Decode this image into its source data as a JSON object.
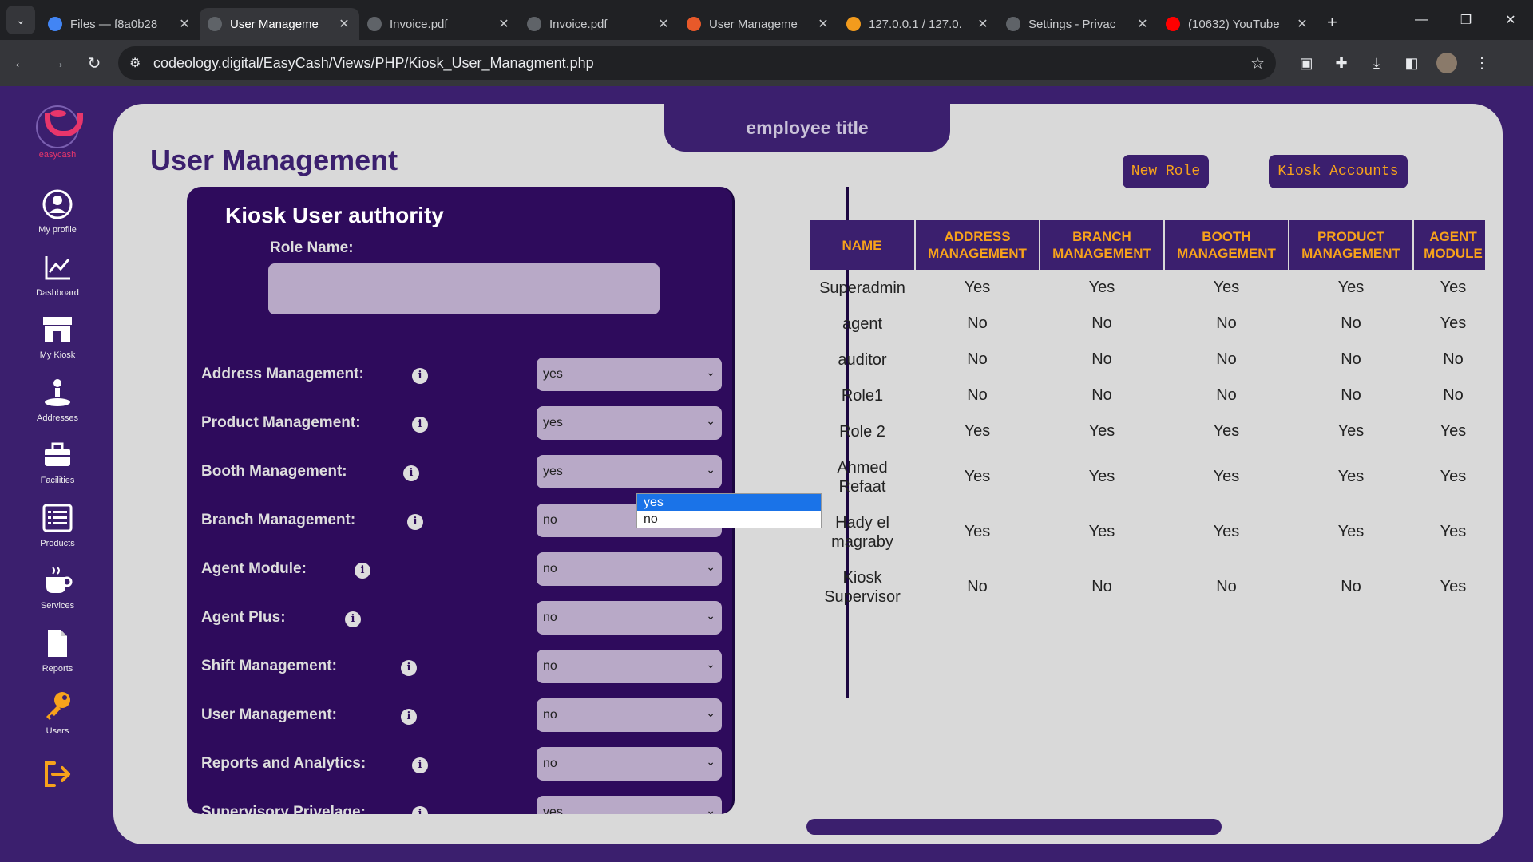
{
  "browser": {
    "tabs": [
      {
        "title": "Files — f8a0b28",
        "icon": "drive-icon",
        "color": "#4285f4"
      },
      {
        "title": "User Manageme",
        "icon": "globe-icon",
        "color": "#5f6368",
        "active": true
      },
      {
        "title": "Invoice.pdf",
        "icon": "globe-icon",
        "color": "#5f6368"
      },
      {
        "title": "Invoice.pdf",
        "icon": "globe-icon",
        "color": "#5f6368"
      },
      {
        "title": "User Manageme",
        "icon": "site-icon",
        "color": "#e8592a"
      },
      {
        "title": "127.0.0.1 / 127.0.",
        "icon": "phpmyadmin-icon",
        "color": "#f29b1d"
      },
      {
        "title": "Settings - Privac",
        "icon": "gear-icon",
        "color": "#5f6368"
      },
      {
        "title": "(10632) YouTube",
        "icon": "youtube-icon",
        "color": "#ff0000"
      }
    ],
    "url": "codeology.digital/EasyCash/Views/PHP/Kiosk_User_Managment.php"
  },
  "sidebar": {
    "brand": "easycash",
    "items": [
      {
        "label": "My profile",
        "icon": "profile-icon"
      },
      {
        "label": "Dashboard",
        "icon": "chart-icon"
      },
      {
        "label": "My Kiosk",
        "icon": "store-icon"
      },
      {
        "label": "Addresses",
        "icon": "location-icon"
      },
      {
        "label": "Facilities",
        "icon": "briefcase-icon"
      },
      {
        "label": "Products",
        "icon": "list-icon"
      },
      {
        "label": "Services",
        "icon": "coffee-icon"
      },
      {
        "label": "Reports",
        "icon": "file-icon"
      },
      {
        "label": "Users",
        "icon": "key-icon"
      }
    ],
    "logout_icon": "logout-icon"
  },
  "header": {
    "employee_title": "employee title",
    "page_title": "User Management",
    "new_role_label": "New Role",
    "kiosk_accounts_label": "Kiosk Accounts"
  },
  "form": {
    "title": "Kiosk User authority",
    "role_name_label": "Role Name:",
    "role_name_value": "",
    "permissions": [
      {
        "label": "Address Management:",
        "value": "yes"
      },
      {
        "label": "Product Management:",
        "value": "yes"
      },
      {
        "label": "Booth Management:",
        "value": "yes"
      },
      {
        "label": "Branch Management:",
        "value": "no"
      },
      {
        "label": "Agent Module:",
        "value": "no"
      },
      {
        "label": "Agent Plus:",
        "value": "no"
      },
      {
        "label": "Shift Management:",
        "value": "no"
      },
      {
        "label": "User Management:",
        "value": "no"
      },
      {
        "label": "Reports and Analytics:",
        "value": "no"
      },
      {
        "label": "Supervisory Privelage:",
        "value": "yes"
      }
    ],
    "dropdown_options": [
      "yes",
      "no"
    ]
  },
  "table": {
    "headers": [
      "NAME",
      "ADDRESS MANAGEMENT",
      "BRANCH MANAGEMENT",
      "BOOTH MANAGEMENT",
      "PRODUCT MANAGEMENT",
      "AGENT MODULE"
    ],
    "rows": [
      [
        "Superadmin",
        "Yes",
        "Yes",
        "Yes",
        "Yes",
        "Yes"
      ],
      [
        "agent",
        "No",
        "No",
        "No",
        "No",
        "Yes"
      ],
      [
        "auditor",
        "No",
        "No",
        "No",
        "No",
        "No"
      ],
      [
        "Role1",
        "No",
        "No",
        "No",
        "No",
        "No"
      ],
      [
        "Role 2",
        "Yes",
        "Yes",
        "Yes",
        "Yes",
        "Yes"
      ],
      [
        "Ahmed Refaat",
        "Yes",
        "Yes",
        "Yes",
        "Yes",
        "Yes"
      ],
      [
        "Hady el magraby",
        "Yes",
        "Yes",
        "Yes",
        "Yes",
        "Yes"
      ],
      [
        "Kiosk Supervisor",
        "No",
        "No",
        "No",
        "No",
        "Yes"
      ]
    ]
  },
  "colors": {
    "brand_purple": "#3b1f6e",
    "accent_orange": "#f7a21b",
    "card_purple": "#2e0b5c",
    "panel_gray": "#d9d9d9"
  }
}
